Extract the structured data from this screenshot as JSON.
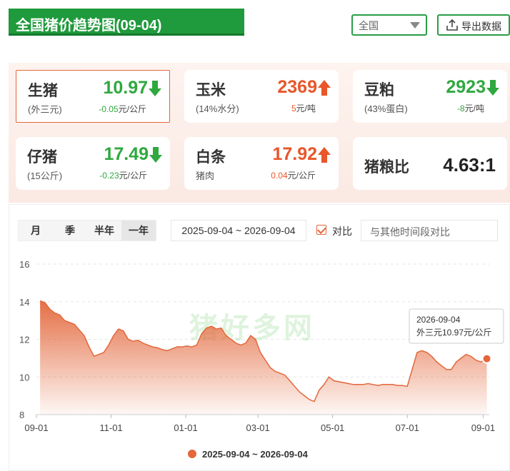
{
  "header": {
    "title": "全国猪价趋势图(09-04)",
    "region_selected": "全国",
    "export_label": "导出数据"
  },
  "cards": [
    {
      "name": "生猪",
      "sub": "(外三元)",
      "price": "10.97",
      "direction": "down",
      "change": "-0.05",
      "unit": "元/公斤",
      "selected": true
    },
    {
      "name": "玉米",
      "sub": "(14%水分)",
      "price": "2369",
      "direction": "up",
      "change": "5",
      "unit": "元/吨",
      "selected": false
    },
    {
      "name": "豆粕",
      "sub": "(43%蛋白)",
      "price": "2923",
      "direction": "down",
      "change": "-8",
      "unit": "元/吨",
      "selected": false
    },
    {
      "name": "仔猪",
      "sub": "(15公斤)",
      "price": "17.49",
      "direction": "down",
      "change": "-0.23",
      "unit": "元/公斤",
      "selected": false
    },
    {
      "name": "白条",
      "sub": "猪肉",
      "price": "17.92",
      "direction": "up",
      "change": "0.04",
      "unit": "元/公斤",
      "selected": false
    }
  ],
  "ratio_card": {
    "name": "猪粮比",
    "value": "4.63:1"
  },
  "controls": {
    "periods": [
      "月",
      "季",
      "半年",
      "一年"
    ],
    "active_period": "一年",
    "date_range": "2025-09-04 ~ 2026-09-04",
    "compare_label": "对比",
    "compare_placeholder": "与其他时间段对比"
  },
  "colors": {
    "brand_green": "#1f9a3c",
    "up_red": "#e8562a",
    "down_green": "#2fa83f",
    "series": "#e3673b"
  },
  "chart_data": {
    "type": "area",
    "series_name": "2025-09-04 ~ 2026-09-04",
    "x_ticks": [
      "09-01",
      "11-01",
      "01-01",
      "03-01",
      "05-01",
      "07-01",
      "09-01"
    ],
    "y_ticks": [
      8,
      10,
      12,
      14,
      16
    ],
    "ylim": [
      8,
      16
    ],
    "xlim": [
      "2025-09-01",
      "2026-09-06"
    ],
    "grid": "horizontal-dashed",
    "legend_position": "bottom-center",
    "tooltip": {
      "date": "2026-09-04",
      "text": "外三元10.97元/公斤"
    },
    "x": [
      "2025-09-04",
      "2025-09-08",
      "2025-09-12",
      "2025-09-16",
      "2025-09-20",
      "2025-09-24",
      "2025-09-28",
      "2025-10-02",
      "2025-10-06",
      "2025-10-10",
      "2025-10-14",
      "2025-10-18",
      "2025-10-22",
      "2025-10-26",
      "2025-10-30",
      "2025-11-03",
      "2025-11-07",
      "2025-11-11",
      "2025-11-15",
      "2025-11-19",
      "2025-11-23",
      "2025-11-27",
      "2025-12-01",
      "2025-12-05",
      "2025-12-09",
      "2025-12-13",
      "2025-12-17",
      "2025-12-21",
      "2025-12-25",
      "2025-12-29",
      "2026-01-02",
      "2026-01-06",
      "2026-01-10",
      "2026-01-14",
      "2026-01-18",
      "2026-01-22",
      "2026-01-26",
      "2026-01-30",
      "2026-02-03",
      "2026-02-07",
      "2026-02-11",
      "2026-02-15",
      "2026-02-19",
      "2026-02-23",
      "2026-02-27",
      "2026-03-03",
      "2026-03-07",
      "2026-03-11",
      "2026-03-15",
      "2026-03-19",
      "2026-03-23",
      "2026-03-27",
      "2026-03-31",
      "2026-04-04",
      "2026-04-08",
      "2026-04-12",
      "2026-04-16",
      "2026-04-20",
      "2026-04-24",
      "2026-04-28",
      "2026-05-02",
      "2026-05-06",
      "2026-05-10",
      "2026-05-14",
      "2026-05-18",
      "2026-05-22",
      "2026-05-26",
      "2026-05-30",
      "2026-06-03",
      "2026-06-07",
      "2026-06-11",
      "2026-06-15",
      "2026-06-19",
      "2026-06-23",
      "2026-06-27",
      "2026-07-01",
      "2026-07-05",
      "2026-07-09",
      "2026-07-13",
      "2026-07-17",
      "2026-07-21",
      "2026-07-25",
      "2026-07-29",
      "2026-08-02",
      "2026-08-06",
      "2026-08-10",
      "2026-08-14",
      "2026-08-18",
      "2026-08-22",
      "2026-08-26",
      "2026-08-30",
      "2026-09-04"
    ],
    "y": [
      14.05,
      13.95,
      13.6,
      13.4,
      13.3,
      13.0,
      12.9,
      12.8,
      12.5,
      12.2,
      11.6,
      11.1,
      11.2,
      11.3,
      11.7,
      12.2,
      12.55,
      12.45,
      12.0,
      11.9,
      11.95,
      11.8,
      11.7,
      11.6,
      11.55,
      11.45,
      11.4,
      11.5,
      11.6,
      11.6,
      11.65,
      11.6,
      11.7,
      12.3,
      12.6,
      12.7,
      12.55,
      12.6,
      12.2,
      12.0,
      11.8,
      11.7,
      11.8,
      12.2,
      12.0,
      11.3,
      10.9,
      10.5,
      10.3,
      10.2,
      10.1,
      9.8,
      9.5,
      9.2,
      9.0,
      8.8,
      8.7,
      9.3,
      9.6,
      10.0,
      9.8,
      9.75,
      9.7,
      9.65,
      9.6,
      9.6,
      9.6,
      9.65,
      9.6,
      9.55,
      9.6,
      9.6,
      9.6,
      9.55,
      9.55,
      9.5,
      10.4,
      11.3,
      11.4,
      11.3,
      11.1,
      10.8,
      10.6,
      10.4,
      10.4,
      10.8,
      11.0,
      11.2,
      11.1,
      10.9,
      10.8,
      10.97
    ]
  }
}
